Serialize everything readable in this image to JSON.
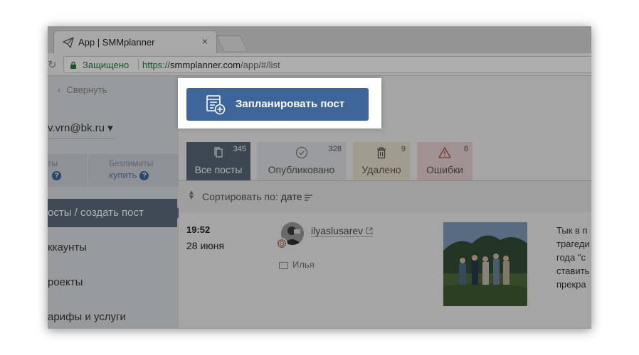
{
  "browser": {
    "tab_title": "App | SMMplanner",
    "tab_close": "×",
    "secure_label": "Защищено",
    "url_scheme": "https://",
    "url_host": "smmplanner.com",
    "url_path": "/app/#/list"
  },
  "sidebar": {
    "collapse_label": "Свернуть",
    "email": "v.vrn@bk.ru ▾",
    "tariff_left_label": "ты",
    "tariff_right_label": "Безлимиты",
    "tariff_buy_label": "купить",
    "help_glyph": "?",
    "items": [
      {
        "label": "осты / создать пост",
        "active": true
      },
      {
        "label": "ккаунты"
      },
      {
        "label": "роекты"
      },
      {
        "label": "арифы и услуги"
      }
    ]
  },
  "main": {
    "plan_button_label": "Запланировать пост",
    "tabs": [
      {
        "label": "Все посты",
        "count": "345"
      },
      {
        "label": "Опубликовано",
        "count": "328"
      },
      {
        "label": "Удалено",
        "count": "9"
      },
      {
        "label": "Ошибки",
        "count": "8"
      }
    ],
    "sort": {
      "label": "Сортировать по:",
      "value": "дате"
    },
    "post": {
      "time": "19:52",
      "date": "28 июня",
      "username": "ilyaslusarev",
      "project": "Илья",
      "text_lines": [
        "Тык в п",
        "трагеди",
        "года \"с",
        "ставить",
        "прекра"
      ]
    }
  },
  "colors": {
    "accent": "#3e6599",
    "sidebar_active": "#5b6b7b",
    "secure_green": "#1e7e34"
  }
}
